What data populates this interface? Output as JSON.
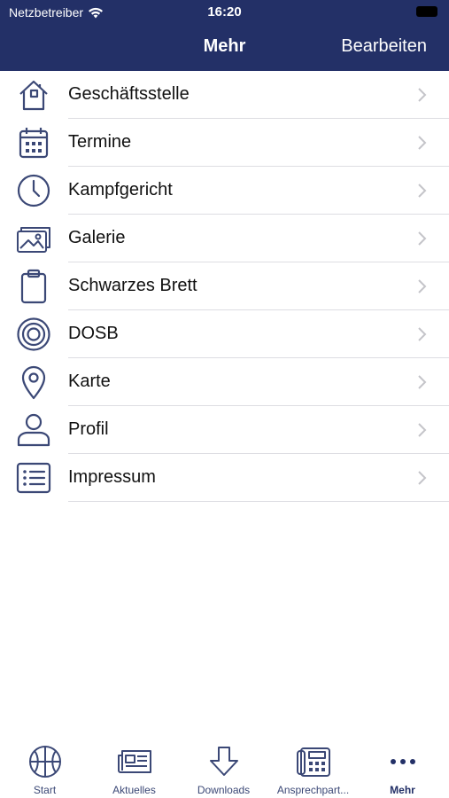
{
  "status": {
    "carrier": "Netzbetreiber",
    "time": "16:20"
  },
  "nav": {
    "title": "Mehr",
    "edit_label": "Bearbeiten"
  },
  "menu": [
    {
      "label": "Geschäftsstelle",
      "icon": "house-icon"
    },
    {
      "label": "Termine",
      "icon": "calendar-icon"
    },
    {
      "label": "Kampfgericht",
      "icon": "clock-icon"
    },
    {
      "label": "Galerie",
      "icon": "gallery-icon"
    },
    {
      "label": "Schwarzes Brett",
      "icon": "clipboard-icon"
    },
    {
      "label": "DOSB",
      "icon": "target-icon"
    },
    {
      "label": "Karte",
      "icon": "map-pin-icon"
    },
    {
      "label": "Profil",
      "icon": "person-icon"
    },
    {
      "label": "Impressum",
      "icon": "list-icon"
    }
  ],
  "tabs": [
    {
      "label": "Start",
      "icon": "basketball-icon"
    },
    {
      "label": "Aktuelles",
      "icon": "newspaper-icon"
    },
    {
      "label": "Downloads",
      "icon": "download-arrow-icon"
    },
    {
      "label": "Ansprechpart...",
      "icon": "phone-icon"
    },
    {
      "label": "Mehr",
      "icon": "more-dots-icon",
      "active": true
    }
  ],
  "colors": {
    "header_bg": "#233067",
    "icon": "#3b4876",
    "separator": "#dddde2"
  }
}
